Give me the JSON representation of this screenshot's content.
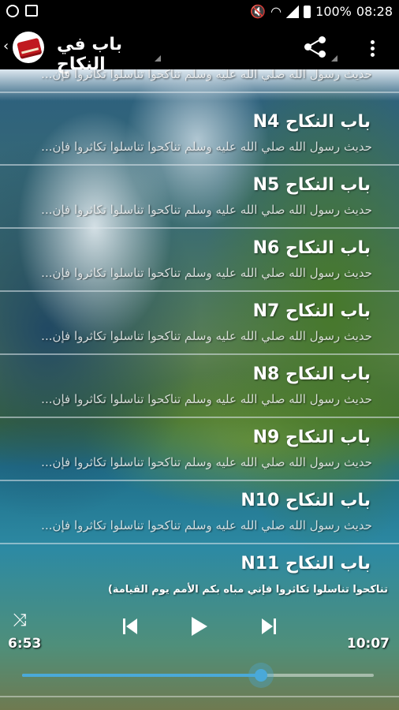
{
  "status": {
    "battery": "100%",
    "time": "08:28"
  },
  "header": {
    "title": "باب في النكاح"
  },
  "list": {
    "items": [
      {
        "title": "",
        "subtitle": "حديث رسول الله صلي الله عليه وسلم تناكحوا تناسلوا تكاثروا فإن..."
      },
      {
        "title": "باب النكاح N4",
        "subtitle": "حديث رسول الله صلي الله عليه وسلم تناكحوا تناسلوا تكاثروا فإن..."
      },
      {
        "title": "باب النكاح N5",
        "subtitle": "حديث رسول الله صلي الله عليه وسلم تناكحوا تناسلوا تكاثروا فإن..."
      },
      {
        "title": "باب النكاح N6",
        "subtitle": "حديث رسول الله صلي الله عليه وسلم تناكحوا تناسلوا تكاثروا فإن..."
      },
      {
        "title": "باب النكاح N7",
        "subtitle": "حديث رسول الله صلي الله عليه وسلم تناكحوا تناسلوا تكاثروا فإن..."
      },
      {
        "title": "باب النكاح N8",
        "subtitle": "حديث رسول الله صلي الله عليه وسلم تناكحوا تناسلوا تكاثروا فإن..."
      },
      {
        "title": "باب النكاح N9",
        "subtitle": "حديث رسول الله صلي الله عليه وسلم تناكحوا تناسلوا تكاثروا فإن..."
      },
      {
        "title": "باب النكاح N10",
        "subtitle": "حديث رسول الله صلي الله عليه وسلم تناكحوا تناسلوا تكاثروا فإن..."
      },
      {
        "title": "باب النكاح N11",
        "subtitle": ""
      }
    ]
  },
  "player": {
    "now_playing": "تناكحوا تناسلوا تكاثروا فإني مباه بكم الأمم يوم القيامة)",
    "current_time": "6:53",
    "duration": "10:07",
    "progress": 0.68,
    "accent": "#4aa9d8"
  }
}
